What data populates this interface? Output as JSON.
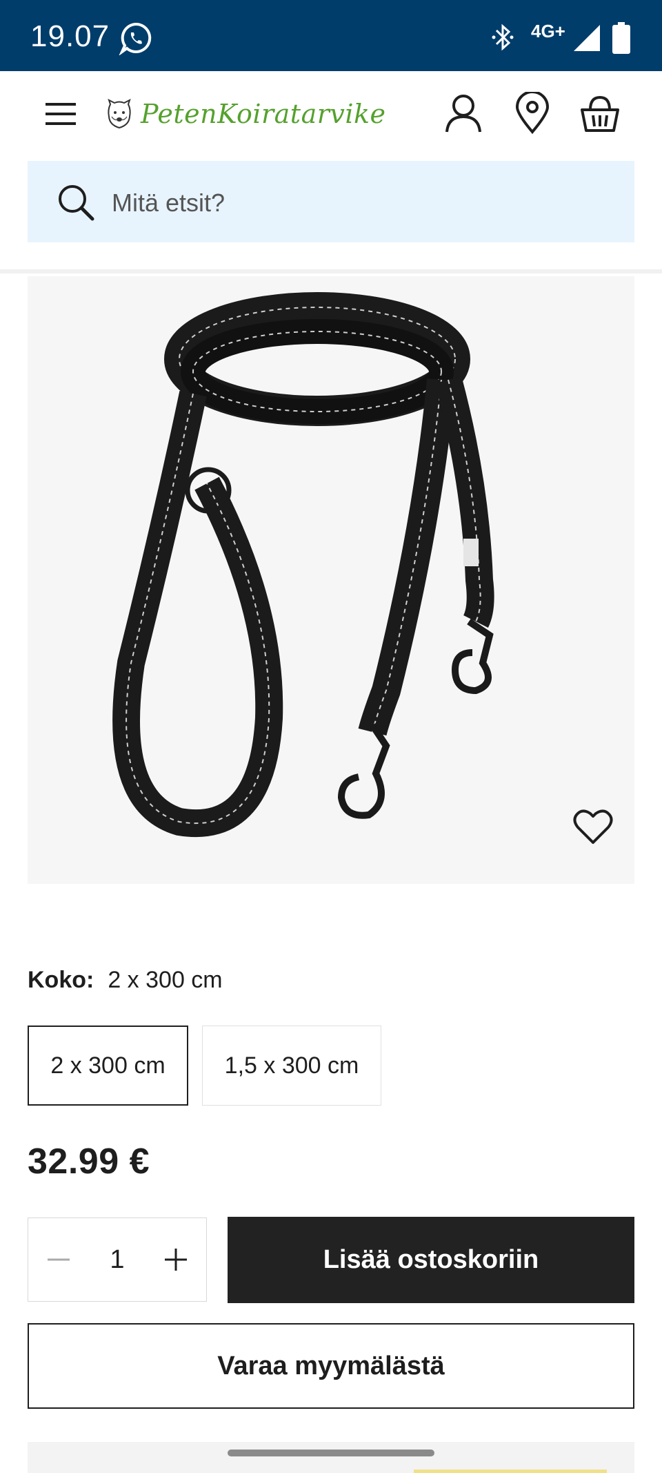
{
  "status_bar": {
    "time": "19.07",
    "network": "4G+"
  },
  "header": {
    "logo_text": "PetenKoiratarvike"
  },
  "search": {
    "placeholder": "Mitä etsit?"
  },
  "product": {
    "size_label": "Koko:",
    "size_value": "2 x 300 cm",
    "size_options": [
      "2 x 300 cm",
      "1,5 x 300 cm"
    ],
    "selected_option_index": 0,
    "price": "32.99 €",
    "quantity": "1",
    "add_to_cart_label": "Lisää ostoskoriin",
    "reserve_label": "Varaa myymälästä"
  },
  "colors": {
    "status_bar_bg": "#003d6b",
    "search_bg": "#e8f4fd",
    "logo_green": "#55a12d",
    "cart_button_bg": "#222222"
  },
  "icons": [
    "whatsapp-icon",
    "bluetooth-icon",
    "signal-icon",
    "battery-icon",
    "menu-icon",
    "account-icon",
    "location-icon",
    "basket-icon",
    "search-icon",
    "heart-icon",
    "minus-icon",
    "plus-icon"
  ]
}
